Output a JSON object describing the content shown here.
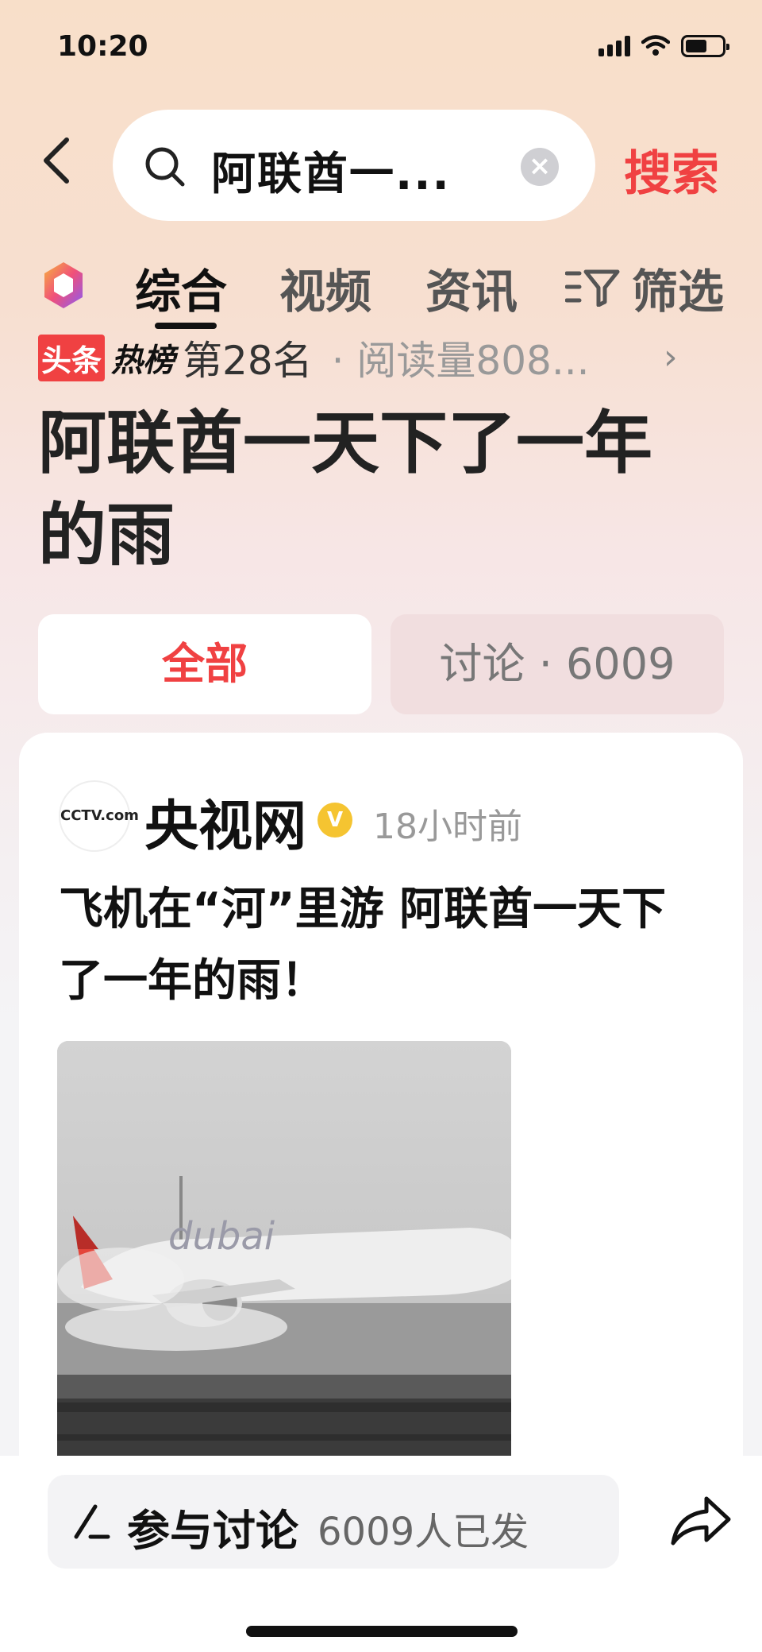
{
  "status_bar": {
    "time": "10:20"
  },
  "header": {
    "search_query": "阿联酋一...",
    "search_button": "搜索",
    "clear_icon": "×"
  },
  "tabs": [
    {
      "label": "综合",
      "active": true
    },
    {
      "label": "视频",
      "active": false
    },
    {
      "label": "资讯",
      "active": false
    },
    {
      "label": "筛选",
      "active": false
    }
  ],
  "hot_rank": {
    "badge_left": "头条",
    "badge_right": "热榜",
    "rank": "第28名",
    "read_count": "· 阅读量808...",
    "chevron": "›"
  },
  "topic_title": "阿联酋一天下了一年的雨",
  "segments": {
    "all": "全部",
    "discussion": "讨论 · 6009"
  },
  "post": {
    "avatar_text": "CCTV.com",
    "author": "央视网",
    "verified_icon": "V",
    "time_ago": "18小时前",
    "title": "飞机在“河”里游 阿联酋一天下了一年的雨！",
    "image_text": "dubai"
  },
  "bottom_bar": {
    "discuss_label": "参与讨论",
    "discuss_count": "6009人已发"
  },
  "colors": {
    "accent_red": "#f04142",
    "verified_gold": "#f5c431"
  }
}
